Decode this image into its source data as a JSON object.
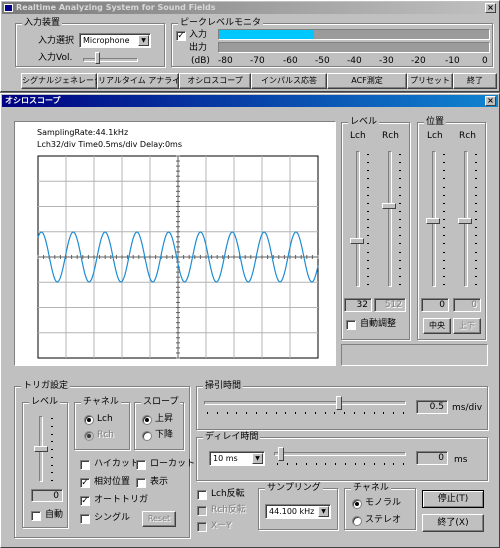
{
  "main_window": {
    "title": "Realtime Analyzing System for Sound Fields",
    "input_group": {
      "label": "入力装置",
      "select_label": "入力選択",
      "device": "Microphone",
      "vol_label": "入力Vol."
    },
    "meter_group": {
      "label": "ピークレベルモニタ",
      "in_label": "入力",
      "out_label": "出力",
      "in_checked": true,
      "in_level_fraction": 0.35,
      "out_level_fraction": 0,
      "scale": [
        "(dB)",
        "-80",
        "-70",
        "-60",
        "-50",
        "-40",
        "-30",
        "-20",
        "-10",
        "0"
      ]
    },
    "toolbar": [
      "シグナルジェネレータ",
      "リアルタイム アナライザ",
      "オシロスコープ",
      "インパルス応答",
      "ACF測定",
      "プリセット",
      "終了"
    ]
  },
  "osc_window": {
    "title": "オシロスコープ",
    "display": {
      "sampling": "SamplingRate:44.1kHz",
      "line2": "Lch32/div   Time0.5ms/div   Delay:0ms"
    },
    "level": {
      "label": "レベル",
      "lch": "Lch",
      "rch": "Rch",
      "lch_value": "32",
      "rch_value": "512",
      "auto_label": "自動調整",
      "auto_checked": false
    },
    "position": {
      "label": "位置",
      "lch": "Lch",
      "rch": "Rch",
      "lch_value": "0",
      "rch_value": "0",
      "center_btn": "中央",
      "up_btn": "上下"
    },
    "trigger": {
      "label": "トリガ設定",
      "level_label": "レベル",
      "level_value": "0",
      "auto_label": "自動",
      "auto_checked": false,
      "channel_label": "チャネル",
      "lch": "Lch",
      "rch": "Rch",
      "slope_label": "スロープ",
      "rise": "上昇",
      "fall": "下降",
      "hicut": "ハイカット",
      "lowcut": "ローカット",
      "relpos": "相対位置",
      "display": "表示",
      "autotrig": "オートトリガ",
      "single": "シングル",
      "reset": "Reset"
    },
    "sweep": {
      "label": "掃引時間",
      "value": "0.5",
      "unit": "ms/div"
    },
    "delay": {
      "label": "ディレイ時間",
      "select": "10 ms",
      "value": "0",
      "unit": "ms"
    },
    "invert": {
      "lch": "Lch反転",
      "rch": "Rch反転",
      "xy": "X－Y"
    },
    "sampling": {
      "label": "サンプリング",
      "select": "44.100 kHz"
    },
    "out_channel": {
      "label": "チャネル",
      "mono": "モノラル",
      "stereo": "ステレオ"
    },
    "stop_btn": "停止(T)",
    "exit_btn": "終了(X)"
  },
  "colors": {
    "waveform": "#1e8cd2",
    "meter": "#00c8ff",
    "title_active": "#000080"
  }
}
